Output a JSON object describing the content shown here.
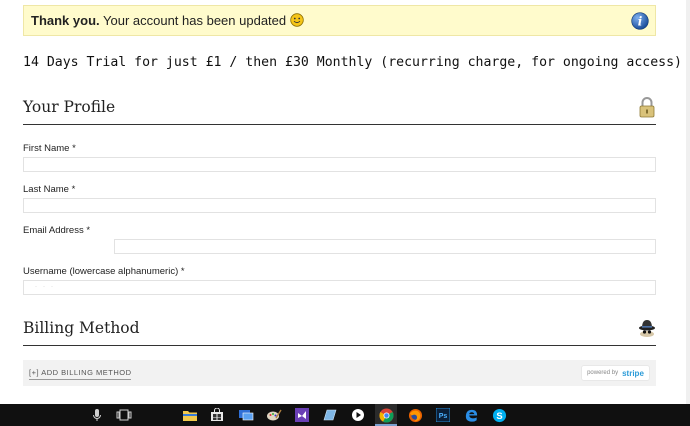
{
  "notice": {
    "strong": "Thank you.",
    "text": " Your account has been updated",
    "emoji": "smiley-face-icon",
    "icon": "info-icon"
  },
  "trial_text": "14 Days Trial for just £1 / then £30 Monthly (recurring charge, for ongoing access)",
  "profile": {
    "title": "Your Profile",
    "icon": "padlock-icon",
    "fields": [
      {
        "label": "First Name *",
        "value": ""
      },
      {
        "label": "Last Name *",
        "value": ""
      },
      {
        "label": "Email Address *",
        "value": ""
      },
      {
        "label": "Username (lowercase alphanumeric) *",
        "value": ""
      }
    ]
  },
  "billing": {
    "title": "Billing Method",
    "icon": "spy-hat-icon",
    "add_label": "[+] ADD BILLING METHOD",
    "powered_by": "powered by",
    "brand": "stripe",
    "brand_color": "#2b9bd8"
  },
  "taskbar": {
    "items": [
      "microphone-icon",
      "task-view-icon",
      "file-explorer-icon",
      "store-icon",
      "remote-desktop-icon",
      "paint-icon",
      "visual-studio-icon",
      "app-icon",
      "media-icon",
      "chrome-icon",
      "firefox-icon",
      "photoshop-icon",
      "edge-icon",
      "skype-icon"
    ],
    "photoshop_label": "Ps"
  }
}
